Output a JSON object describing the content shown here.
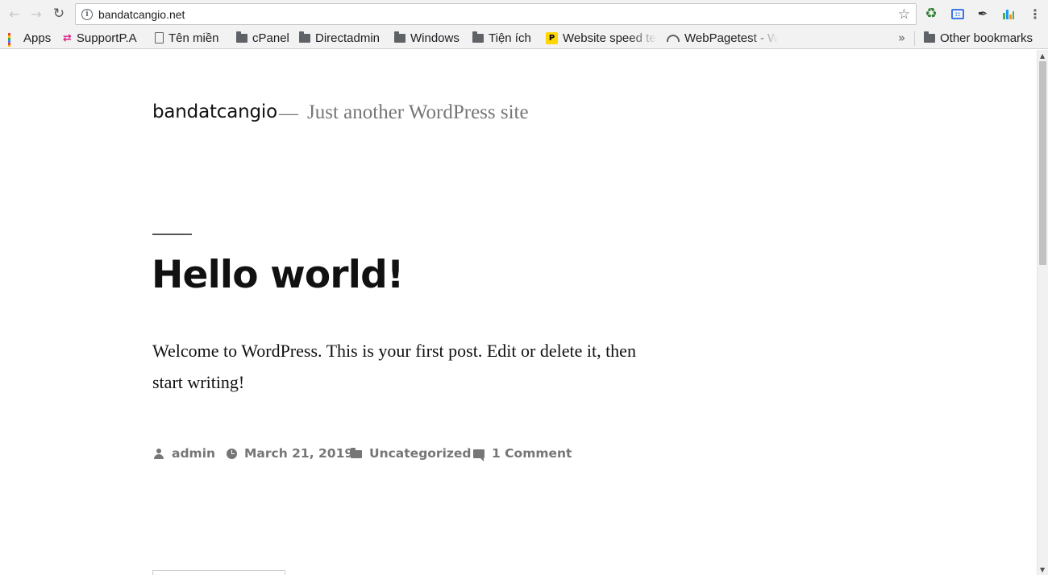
{
  "browser": {
    "url": "bandatcangio.net",
    "bookmarks": [
      {
        "label": "Apps",
        "icon": "apps-grid-icon"
      },
      {
        "label": "SupportP.A",
        "icon": "supportpa-icon"
      },
      {
        "label": "Tên miền",
        "icon": "page-icon"
      },
      {
        "label": "cPanel",
        "icon": "folder-icon"
      },
      {
        "label": "Directadmin",
        "icon": "folder-icon"
      },
      {
        "label": "Windows",
        "icon": "folder-icon"
      },
      {
        "label": "Tiện ích",
        "icon": "folder-icon"
      },
      {
        "label": "Website speed te",
        "icon": "p-badge-icon"
      },
      {
        "label": "WebPagetest - W",
        "icon": "gauge-icon"
      }
    ],
    "overflow_chevron": "»",
    "other_bookmarks": "Other bookmarks",
    "extension_icons": [
      "recycle-icon",
      "blue-extension-icon",
      "eyedropper-icon",
      "bar-chart-icon",
      "kebab-menu-icon"
    ]
  },
  "site": {
    "name": "bandatcangio",
    "separator": "—",
    "description": "Just another WordPress site"
  },
  "post": {
    "title": "Hello world!",
    "content": "Welcome to WordPress. This is your first post. Edit or delete it, then start writing!",
    "meta": {
      "author": "admin",
      "date": "March 21, 2019",
      "category": "Uncategorized",
      "comments": "1 Comment"
    }
  },
  "colors": {
    "text": "#111111",
    "meta_gray": "#767676",
    "chrome_bg": "#f2f2f2"
  }
}
